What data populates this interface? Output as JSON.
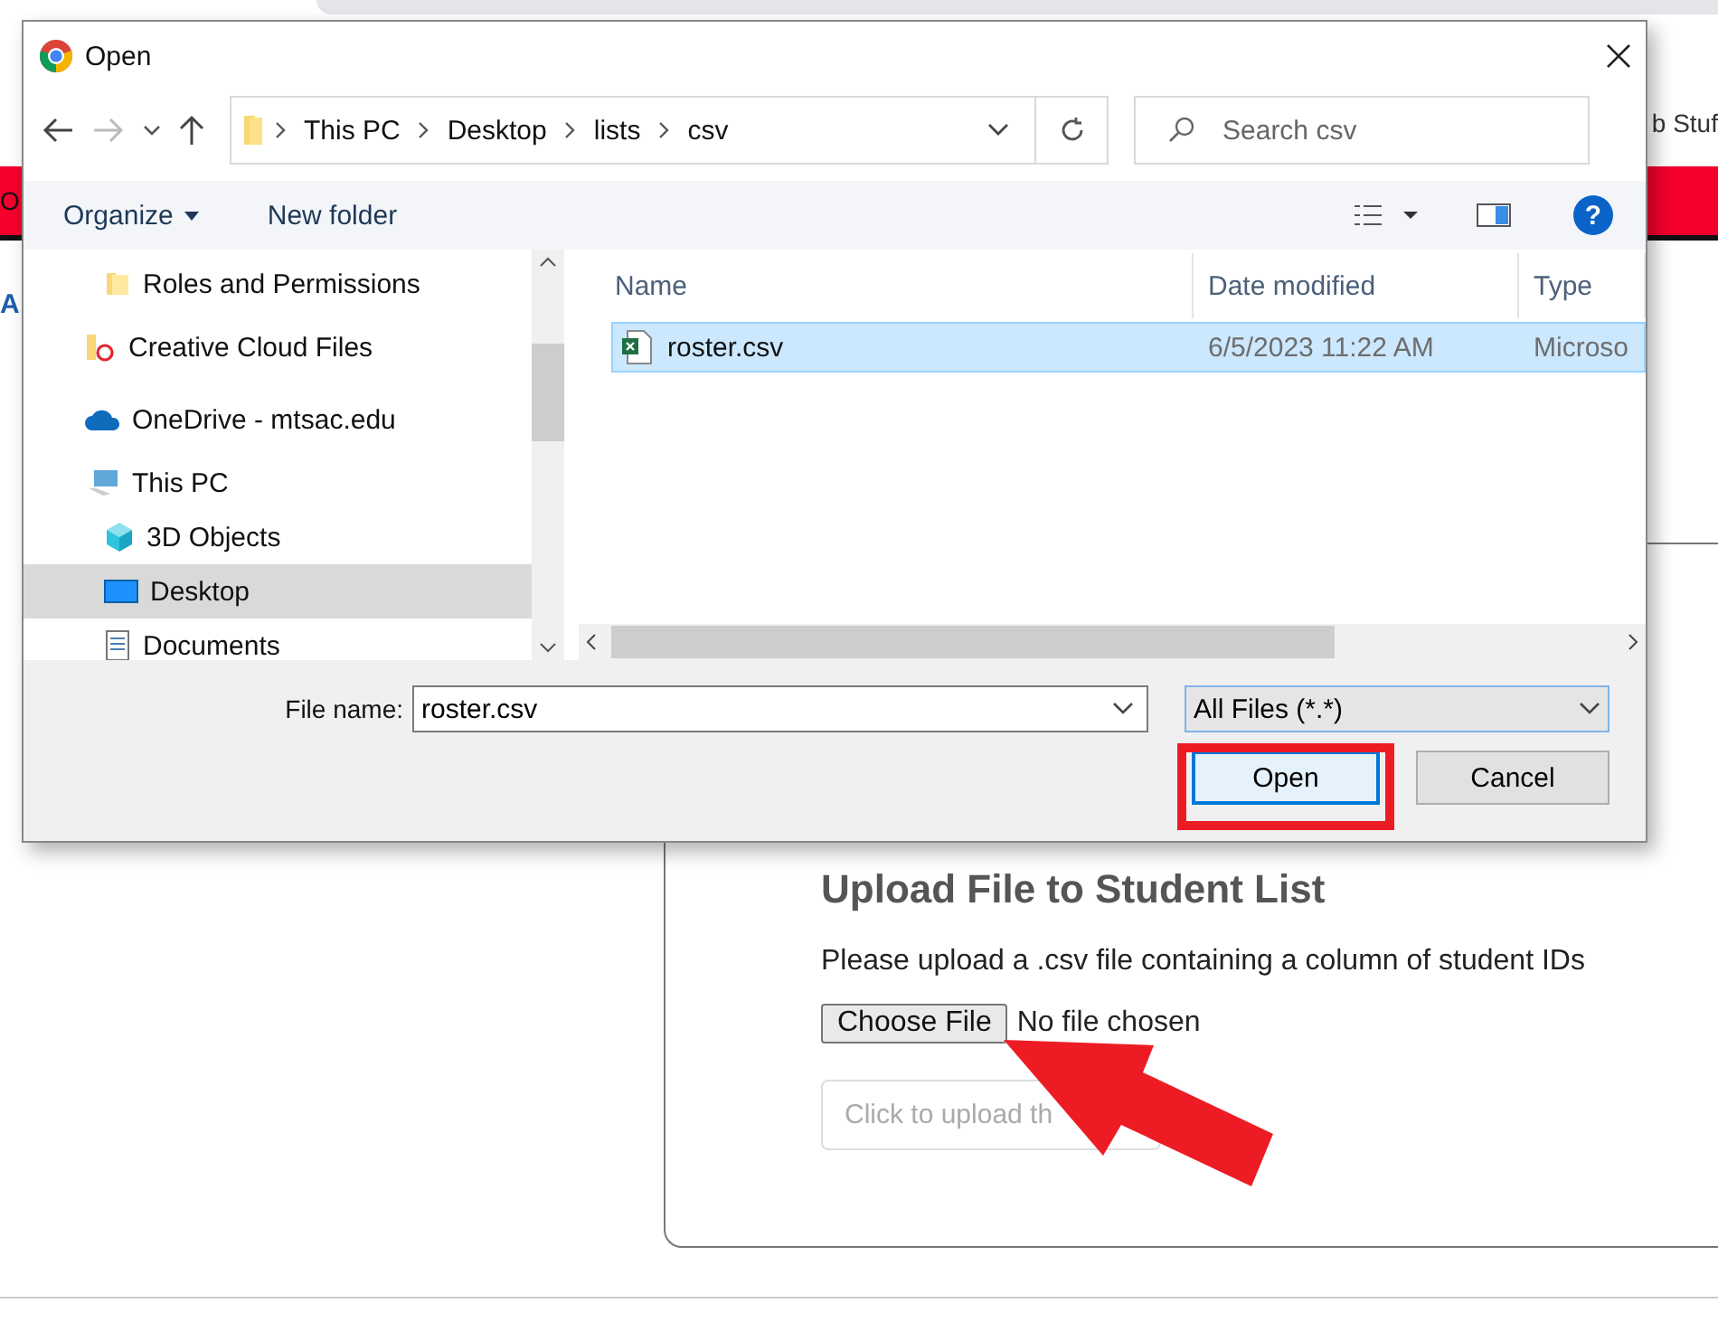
{
  "browser": {
    "bookmark_text": "b Stuf",
    "banner_text": "O",
    "heading_text": "A"
  },
  "upload_card": {
    "title": "Upload File to Student List",
    "instructions": "Please upload a .csv file containing a column of student IDs",
    "choose_button": "Choose File",
    "file_status": "No file chosen",
    "upload_button": {
      "label": "Click to upload th",
      "disabled": true
    }
  },
  "dialog": {
    "title": "Open",
    "breadcrumb": [
      "This PC",
      "Desktop",
      "lists",
      "csv"
    ],
    "search": {
      "placeholder": "Search csv"
    },
    "toolbar": {
      "organize": "Organize",
      "new_folder": "New folder",
      "help": "?"
    },
    "nav": [
      {
        "children": [
          {
            "label": "Roles and Permissions",
            "kind": "folder",
            "selected": false
          }
        ]
      },
      {
        "label": "Creative Cloud Files",
        "kind": "ccfolder",
        "selected": false
      },
      {
        "label": "OneDrive - mtsac.edu",
        "kind": "cloud",
        "selected": false
      },
      {
        "label": "This PC",
        "kind": "computer",
        "selected": false,
        "children": [
          {
            "label": "3D Objects",
            "kind": "cube",
            "selected": false
          },
          {
            "label": "Desktop",
            "kind": "desktop",
            "selected": true
          },
          {
            "label": "Documents",
            "kind": "document",
            "selected": false
          }
        ]
      }
    ],
    "columns": [
      "Name",
      "Date modified",
      "Type"
    ],
    "files": [
      {
        "name": "roster.csv",
        "date": "6/5/2023 11:22 AM",
        "type": "Microso",
        "selected": true
      }
    ],
    "file_name_label": "File name:",
    "file_name": "roster.csv",
    "filter": "All Files (*.*)",
    "buttons": [
      {
        "label": "Open",
        "highlighted": true
      },
      {
        "label": "Cancel",
        "highlighted": false
      }
    ]
  }
}
